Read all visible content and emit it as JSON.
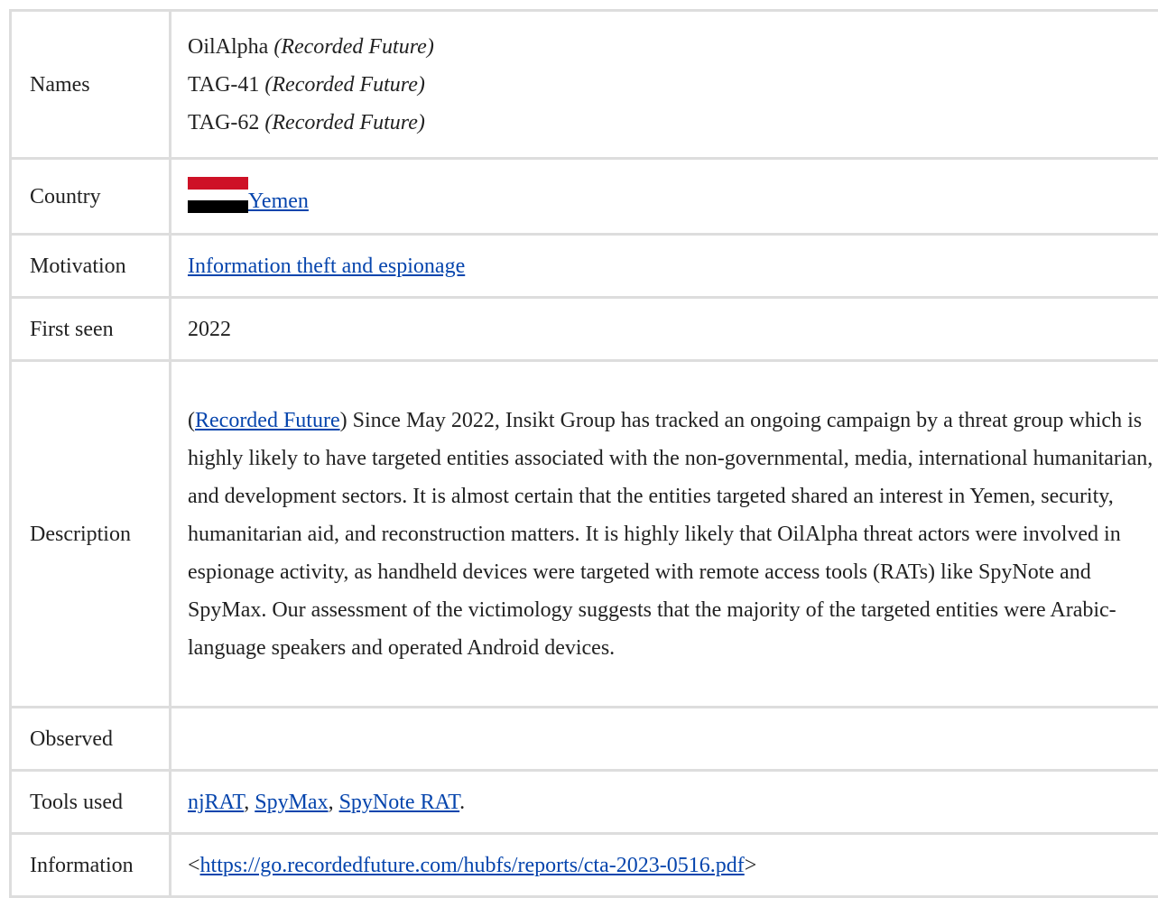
{
  "rows": {
    "names": {
      "label": "Names",
      "items": [
        {
          "name": "OilAlpha",
          "source": "(Recorded Future)"
        },
        {
          "name": "TAG-41",
          "source": "(Recorded Future)"
        },
        {
          "name": "TAG-62",
          "source": "(Recorded Future)"
        }
      ]
    },
    "country": {
      "label": "Country",
      "value": " Yemen",
      "flag_colors": [
        "#ce1126",
        "#ffffff",
        "#000000"
      ]
    },
    "motivation": {
      "label": "Motivation",
      "value": "Information theft and espionage"
    },
    "first_seen": {
      "label": "First seen",
      "value": "2022"
    },
    "description": {
      "label": "Description",
      "open_paren": "(",
      "source_link": "Recorded Future",
      "text": ") Since May 2022, Insikt Group has tracked an ongoing campaign by a threat group which is highly likely to have targeted entities associated with the non-governmental, media, international humanitarian, and development sectors. It is almost certain that the entities targeted shared an interest in Yemen, security, humanitarian aid, and reconstruction matters. It is highly likely that OilAlpha threat actors were involved in espionage activity, as handheld devices were targeted with remote access tools (RATs) like SpyNote and SpyMax. Our assessment of the victimology suggests that the majority of the targeted entities were Arabic-language speakers and operated Android devices."
    },
    "observed": {
      "label": "Observed",
      "value": ""
    },
    "tools": {
      "label": "Tools used",
      "items": [
        "njRAT",
        "SpyMax",
        "SpyNote RAT"
      ],
      "sep": ", ",
      "end": "."
    },
    "information": {
      "label": "Information",
      "open": "<",
      "url": "https://go.recordedfuture.com/hubfs/reports/cta-2023-0516.pdf",
      "close": ">"
    }
  },
  "colors": {
    "link": "#0645ad",
    "border": "#dddddd",
    "text": "#222222"
  }
}
